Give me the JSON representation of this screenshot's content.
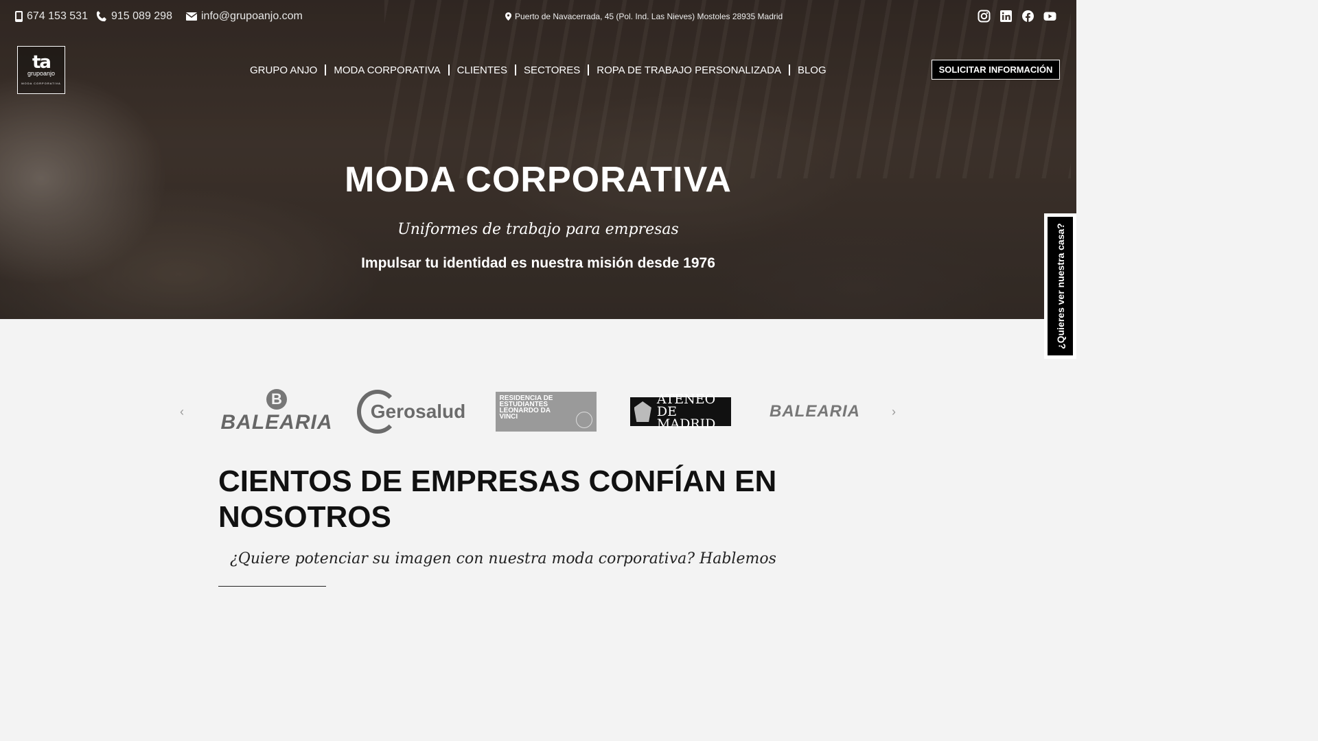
{
  "topbar": {
    "mobile": "674 153 531",
    "phone": "915 089 298",
    "email": "info@grupoanjo.com",
    "address": "Puerto de Navacerrada, 45 (Pol. Ind. Las Nieves) Mostoles 28935 Madrid",
    "socials": [
      "instagram-icon",
      "linkedin-icon",
      "facebook-icon",
      "youtube-icon"
    ]
  },
  "logo": {
    "mark": "ta",
    "name": "grupoanjo",
    "tagline": "MODA CORPORATIVA"
  },
  "nav": {
    "items": [
      "GRUPO ANJO",
      "MODA CORPORATIVA",
      "CLIENTES",
      "SECTORES",
      "ROPA DE TRABAJO PERSONALIZADA",
      "BLOG"
    ]
  },
  "cta_label": "SOLICITAR INFORMACIÓN",
  "hero": {
    "title": "MODA CORPORATIVA",
    "subtitle": "Uniformes de trabajo para empresas",
    "tagline": "Impulsar tu identidad es nuestra misión desde 1976"
  },
  "side_tab": "¿Quieres ver nuestra casa?",
  "clients": {
    "prev": "‹",
    "next": "›",
    "logos": [
      {
        "name": "BALEARIA",
        "mark": "B"
      },
      {
        "name": "Gerosalud"
      },
      {
        "name": "RESIDENCIA DE ESTUDIANTES LEONARDO DA VINCI"
      },
      {
        "name": "ATENEO DE MADRID"
      },
      {
        "name": "BALEARIA"
      }
    ]
  },
  "section": {
    "title": "CIENTOS DE EMPRESAS CONFÍAN EN NOSOTROS",
    "subtitle": "¿Quiere potenciar su imagen con nuestra moda corporativa? Hablemos"
  }
}
